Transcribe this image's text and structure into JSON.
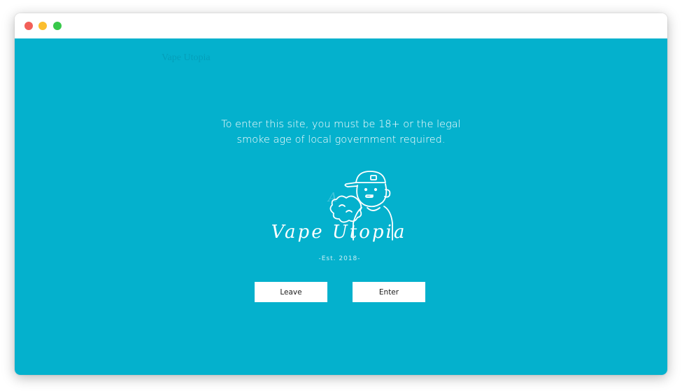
{
  "window": {
    "controls": [
      "close",
      "minimize",
      "maximize"
    ]
  },
  "background": {
    "faint_text": "Vape Utopia"
  },
  "age_gate": {
    "message_line1": "To enter this site, you must be 18+ or the legal",
    "message_line2": "smoke age of local government required.",
    "logo_title": "Vape Utopia",
    "logo_tagline": "-Est. 2018-",
    "leave_label": "Leave",
    "enter_label": "Enter"
  },
  "colors": {
    "overlay": "#04b1cd",
    "button_bg": "#ffffff",
    "text": "#ffffff"
  },
  "icons": [
    "close-dot-icon",
    "minimize-dot-icon",
    "maximize-dot-icon",
    "vaper-mascot-icon"
  ]
}
